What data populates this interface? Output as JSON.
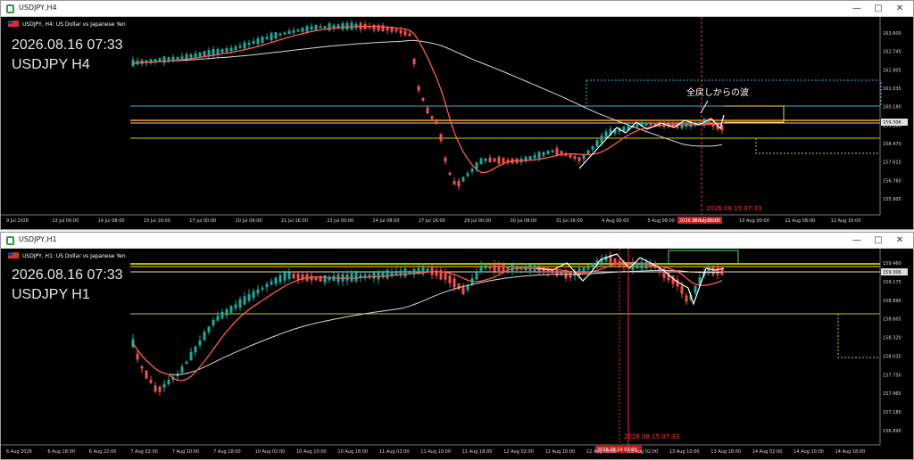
{
  "windows": [
    {
      "title": "USDJPY,H4",
      "header_text": "USDJPY, H4:  US Dollar vs Japanese Yen",
      "overlay_datetime": "2026.08.16 07:33",
      "overlay_symbol": "USDJPY H4",
      "annotation": "全戻しからの波",
      "cursor_time_label": "2026.08.15 07:33",
      "cursor_time_label_bg": "2026.08.14 00:00",
      "cursor_price_label": "159.306",
      "price_labels": [
        "163.600",
        "162.745",
        "161.905",
        "161.035",
        "160.180",
        "159.306",
        "158.470",
        "157.615",
        "156.760",
        "155.905"
      ],
      "time_labels": [
        "9 Jul 2026",
        "13 Jul 00:00",
        "14 Jul 08:00",
        "15 Jul 16:00",
        "17 Jul 00:00",
        "20 Jul 08:00",
        "21 Jul 16:00",
        "23 Jul 00:00",
        "24 Jul 08:00",
        "27 Jul 16:00",
        "29 Jul 00:00",
        "30 Jul 08:00",
        "31 Jul 16:00",
        "4 Aug 00:00",
        "5 Aug 08:00",
        "6 Aug 16:00",
        "10 Aug 00:00",
        "11 Aug 08:00",
        "12 Aug 16:00"
      ],
      "controls": {
        "minimize": "—",
        "maximize": "□",
        "close": "✕"
      }
    },
    {
      "title": "USDJPY,H1",
      "header_text": "USDJPY, H1:  US Dollar vs Japanese Yen",
      "overlay_datetime": "2026.08.16 07:33",
      "overlay_symbol": "USDJPY H1",
      "cursor_time_label": "2026.08.15 07:33",
      "cursor_time_label_bg": "2026.08.14 02:00",
      "cursor_price_label": "159.306",
      "price_labels": [
        "159.460",
        "159.175",
        "158.890",
        "158.605",
        "158.320",
        "158.035",
        "157.750",
        "157.465",
        "157.180",
        "156.895"
      ],
      "time_labels": [
        "6 Aug 2026",
        "6 Aug 18:00",
        "6 Aug 22:00",
        "7 Aug 02:00",
        "7 Aug 10:00",
        "7 Aug 18:00",
        "10 Aug 02:00",
        "10 Aug 10:00",
        "10 Aug 18:00",
        "11 Aug 02:00",
        "11 Aug 10:00",
        "11 Aug 18:00",
        "12 Aug 02:00",
        "12 Aug 10:00",
        "12 Aug 18:00",
        "13 Aug 02:00",
        "13 Aug 10:00",
        "13 Aug 18:00",
        "14 Aug 02:00",
        "14 Aug 10:00",
        "14 Aug 18:00"
      ],
      "controls": {
        "minimize": "—",
        "maximize": "□",
        "close": "✕"
      }
    }
  ],
  "colors": {
    "background": "#000000",
    "bull_candle": "#26a69a",
    "bear_candle": "#ef5350",
    "ma_fast": "#ff5a4a",
    "ma_slow": "#d9d9d9",
    "level_orange": "#ffa500",
    "level_yellow": "#c8c832",
    "level_cyan": "#4ab0c8",
    "cursor_line": "#ff2a2a",
    "zigzag": "#ffffff"
  }
}
